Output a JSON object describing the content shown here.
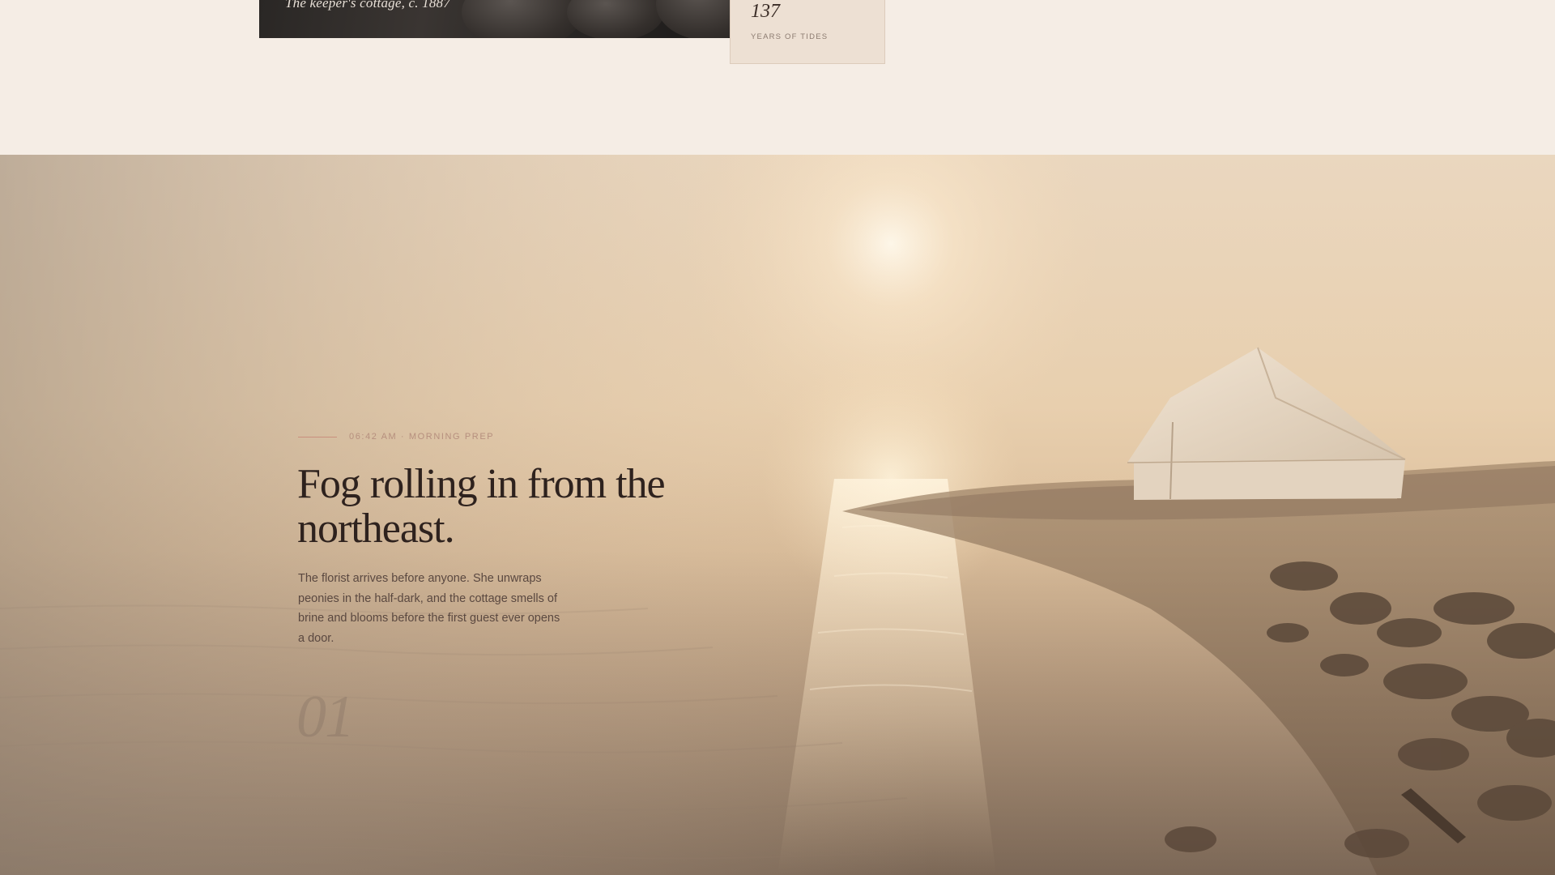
{
  "archive_card": {
    "caption": "The keeper's cottage, c. 1887"
  },
  "stat": {
    "number": "137",
    "label": "YEARS OF TIDES"
  },
  "scene": {
    "eyebrow": "06:42 AM · MORNING PREP",
    "headline": "Fog rolling in from the northeast.",
    "body": "The florist arrives before anyone. She unwraps peonies in the half-dark, and the cottage smells of brine and blooms before the first guest ever opens a door.",
    "chapter_number": "01"
  },
  "colors": {
    "page_background": "#f5ede5",
    "stat_card": "#ede0d3",
    "accent_rule": "#c98f7d",
    "headline": "#2e221e",
    "body_text": "#5a4840"
  }
}
